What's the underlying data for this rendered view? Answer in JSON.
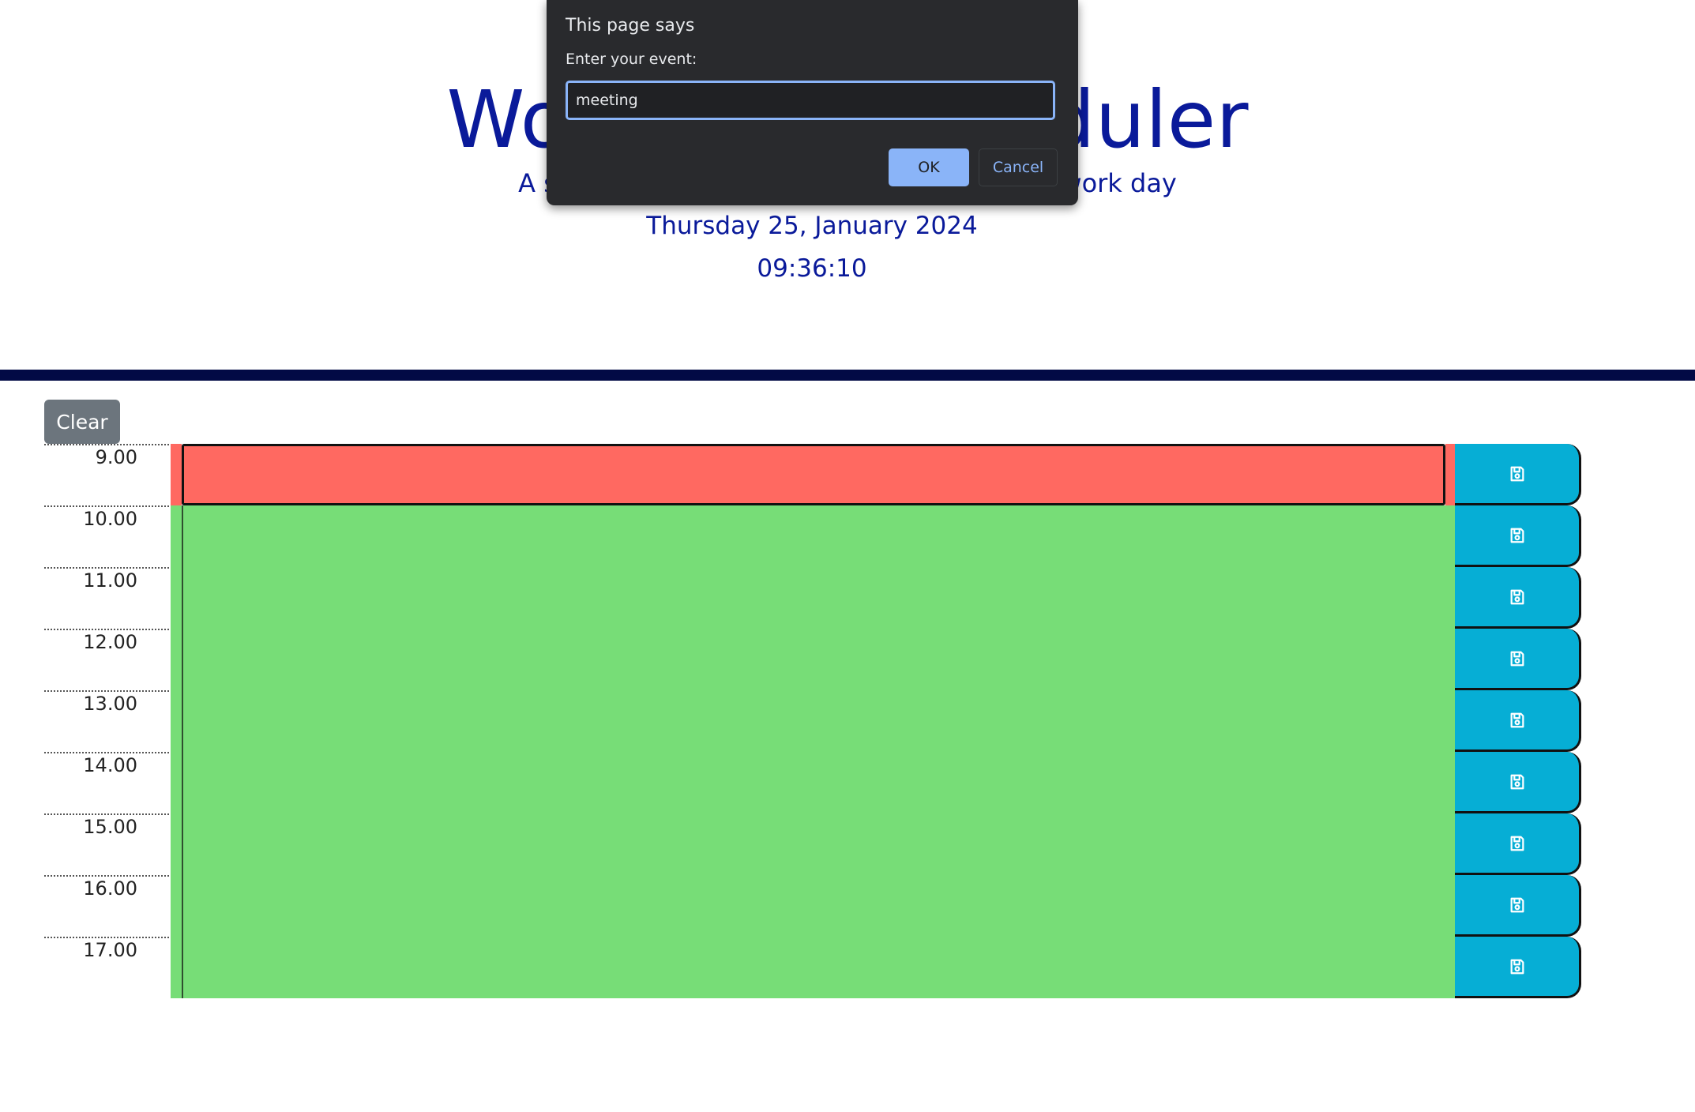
{
  "header": {
    "title": "Work Day Scheduler",
    "subtitle": "A simple calendar app for scheduling your work day",
    "date": "Thursday 25, January 2024",
    "time": "09:36:10"
  },
  "controls": {
    "clear_label": "Clear"
  },
  "schedule": {
    "hours": [
      "9.00",
      "10.00",
      "11.00",
      "12.00",
      "13.00",
      "14.00",
      "15.00",
      "16.00",
      "17.00"
    ],
    "save_icon": "floppy-disk-icon",
    "colors": {
      "past": "#ff6961",
      "future": "#77dd77",
      "save": "#06aed5"
    }
  },
  "dialog": {
    "title": "This page says",
    "message": "Enter your event:",
    "input_value": "meeting",
    "ok_label": "OK",
    "cancel_label": "Cancel"
  }
}
